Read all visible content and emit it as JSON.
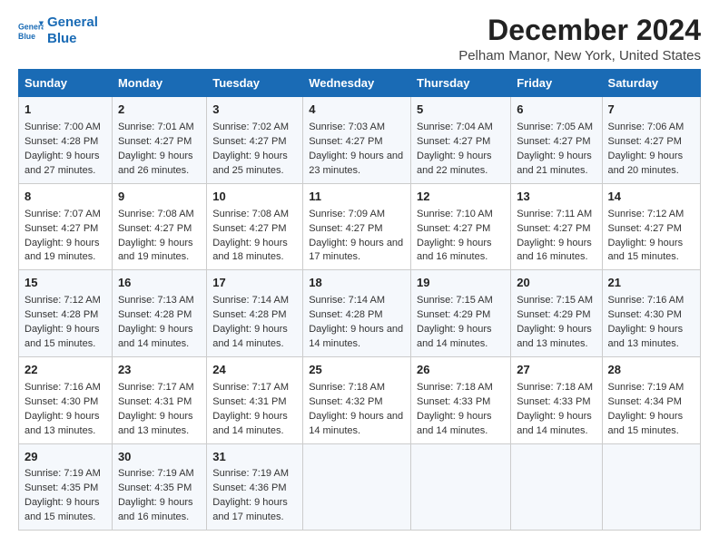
{
  "logo": {
    "line1": "General",
    "line2": "Blue"
  },
  "title": "December 2024",
  "subtitle": "Pelham Manor, New York, United States",
  "days_of_week": [
    "Sunday",
    "Monday",
    "Tuesday",
    "Wednesday",
    "Thursday",
    "Friday",
    "Saturday"
  ],
  "weeks": [
    [
      {
        "day": 1,
        "sunrise": "7:00 AM",
        "sunset": "4:28 PM",
        "daylight": "9 hours and 27 minutes."
      },
      {
        "day": 2,
        "sunrise": "7:01 AM",
        "sunset": "4:27 PM",
        "daylight": "9 hours and 26 minutes."
      },
      {
        "day": 3,
        "sunrise": "7:02 AM",
        "sunset": "4:27 PM",
        "daylight": "9 hours and 25 minutes."
      },
      {
        "day": 4,
        "sunrise": "7:03 AM",
        "sunset": "4:27 PM",
        "daylight": "9 hours and 23 minutes."
      },
      {
        "day": 5,
        "sunrise": "7:04 AM",
        "sunset": "4:27 PM",
        "daylight": "9 hours and 22 minutes."
      },
      {
        "day": 6,
        "sunrise": "7:05 AM",
        "sunset": "4:27 PM",
        "daylight": "9 hours and 21 minutes."
      },
      {
        "day": 7,
        "sunrise": "7:06 AM",
        "sunset": "4:27 PM",
        "daylight": "9 hours and 20 minutes."
      }
    ],
    [
      {
        "day": 8,
        "sunrise": "7:07 AM",
        "sunset": "4:27 PM",
        "daylight": "9 hours and 19 minutes."
      },
      {
        "day": 9,
        "sunrise": "7:08 AM",
        "sunset": "4:27 PM",
        "daylight": "9 hours and 19 minutes."
      },
      {
        "day": 10,
        "sunrise": "7:08 AM",
        "sunset": "4:27 PM",
        "daylight": "9 hours and 18 minutes."
      },
      {
        "day": 11,
        "sunrise": "7:09 AM",
        "sunset": "4:27 PM",
        "daylight": "9 hours and 17 minutes."
      },
      {
        "day": 12,
        "sunrise": "7:10 AM",
        "sunset": "4:27 PM",
        "daylight": "9 hours and 16 minutes."
      },
      {
        "day": 13,
        "sunrise": "7:11 AM",
        "sunset": "4:27 PM",
        "daylight": "9 hours and 16 minutes."
      },
      {
        "day": 14,
        "sunrise": "7:12 AM",
        "sunset": "4:27 PM",
        "daylight": "9 hours and 15 minutes."
      }
    ],
    [
      {
        "day": 15,
        "sunrise": "7:12 AM",
        "sunset": "4:28 PM",
        "daylight": "9 hours and 15 minutes."
      },
      {
        "day": 16,
        "sunrise": "7:13 AM",
        "sunset": "4:28 PM",
        "daylight": "9 hours and 14 minutes."
      },
      {
        "day": 17,
        "sunrise": "7:14 AM",
        "sunset": "4:28 PM",
        "daylight": "9 hours and 14 minutes."
      },
      {
        "day": 18,
        "sunrise": "7:14 AM",
        "sunset": "4:28 PM",
        "daylight": "9 hours and 14 minutes."
      },
      {
        "day": 19,
        "sunrise": "7:15 AM",
        "sunset": "4:29 PM",
        "daylight": "9 hours and 14 minutes."
      },
      {
        "day": 20,
        "sunrise": "7:15 AM",
        "sunset": "4:29 PM",
        "daylight": "9 hours and 13 minutes."
      },
      {
        "day": 21,
        "sunrise": "7:16 AM",
        "sunset": "4:30 PM",
        "daylight": "9 hours and 13 minutes."
      }
    ],
    [
      {
        "day": 22,
        "sunrise": "7:16 AM",
        "sunset": "4:30 PM",
        "daylight": "9 hours and 13 minutes."
      },
      {
        "day": 23,
        "sunrise": "7:17 AM",
        "sunset": "4:31 PM",
        "daylight": "9 hours and 13 minutes."
      },
      {
        "day": 24,
        "sunrise": "7:17 AM",
        "sunset": "4:31 PM",
        "daylight": "9 hours and 14 minutes."
      },
      {
        "day": 25,
        "sunrise": "7:18 AM",
        "sunset": "4:32 PM",
        "daylight": "9 hours and 14 minutes."
      },
      {
        "day": 26,
        "sunrise": "7:18 AM",
        "sunset": "4:33 PM",
        "daylight": "9 hours and 14 minutes."
      },
      {
        "day": 27,
        "sunrise": "7:18 AM",
        "sunset": "4:33 PM",
        "daylight": "9 hours and 14 minutes."
      },
      {
        "day": 28,
        "sunrise": "7:19 AM",
        "sunset": "4:34 PM",
        "daylight": "9 hours and 15 minutes."
      }
    ],
    [
      {
        "day": 29,
        "sunrise": "7:19 AM",
        "sunset": "4:35 PM",
        "daylight": "9 hours and 15 minutes."
      },
      {
        "day": 30,
        "sunrise": "7:19 AM",
        "sunset": "4:35 PM",
        "daylight": "9 hours and 16 minutes."
      },
      {
        "day": 31,
        "sunrise": "7:19 AM",
        "sunset": "4:36 PM",
        "daylight": "9 hours and 17 minutes."
      },
      null,
      null,
      null,
      null
    ]
  ]
}
